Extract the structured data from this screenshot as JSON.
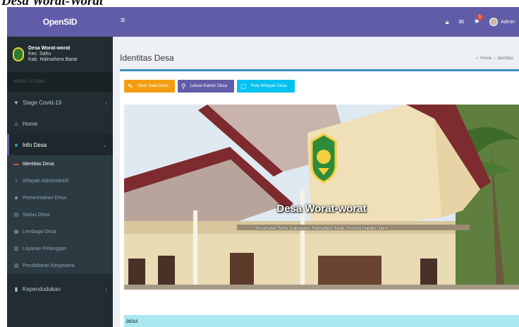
{
  "caption": "Desa Worat-Worat",
  "sidebar": {
    "brand": "OpenSID",
    "user": {
      "name": "Desa Worat-worat",
      "line1": "Kec. Sahu",
      "line2": "Kab. Halmahera Barat"
    },
    "menu_header": "MENU UTAMA",
    "items": [
      {
        "label": "Stage Covid-19",
        "icon": "heart-icon",
        "has_chevron": true
      },
      {
        "label": "Home",
        "icon": "home-icon",
        "has_chevron": false
      },
      {
        "label": "Info Desa",
        "icon": "info-icon",
        "has_chevron": true,
        "open": true
      }
    ],
    "sub_items": [
      {
        "label": "Identitas Desa",
        "icon": "id-card-icon",
        "active": true
      },
      {
        "label": "Wilayah Administratif",
        "icon": "map-icon"
      },
      {
        "label": "Pemerintahan Desa",
        "icon": "users-icon"
      },
      {
        "label": "Status Desa",
        "icon": "chart-icon"
      },
      {
        "label": "Lembaga Desa",
        "icon": "building-icon"
      },
      {
        "label": "Layanan Pelanggan",
        "icon": "support-icon"
      },
      {
        "label": "Pendaftaran Kerjasama",
        "icon": "handshake-icon"
      }
    ],
    "bottom_item": {
      "label": "Kependudukan",
      "icon": "people-icon"
    }
  },
  "navbar": {
    "admin_label": "Admin",
    "badge_count": "1",
    "accent": "#605ca8"
  },
  "content": {
    "page_title": "Identitas Desa",
    "breadcrumb_home": "Home",
    "breadcrumb_current": "Identitas",
    "buttons": [
      {
        "label": "Ubah Data Desa",
        "color": "#f39c12"
      },
      {
        "label": "Lokasi Kantor Desa",
        "color": "#605ca8"
      },
      {
        "label": "Peta Wilayah Desa",
        "color": "#00c0ef"
      }
    ],
    "hero_title": "Desa Worat-worat",
    "hero_subtitle": "Kecamatan Sahu, Kabupaten Halmahera Barat, Provinsi Maluku Utara",
    "section_label": "DESA"
  }
}
